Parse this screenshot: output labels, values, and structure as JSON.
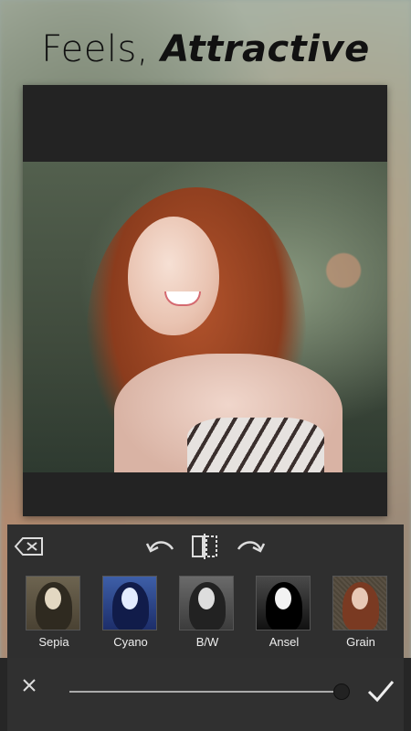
{
  "headline": {
    "light": "Feels, ",
    "bold": "Attractive"
  },
  "toolbar": {
    "erase_icon": "backspace-icon",
    "undo_icon": "undo-icon",
    "compare_icon": "compare-icon",
    "redo_icon": "redo-icon"
  },
  "filters": [
    {
      "label": "Sepia"
    },
    {
      "label": "Cyano"
    },
    {
      "label": "B/W"
    },
    {
      "label": "Ansel"
    },
    {
      "label": "Grain"
    }
  ],
  "bottom": {
    "close_icon": "close-icon",
    "confirm_icon": "check-icon",
    "intensity": 1.0
  },
  "colors": {
    "tray": "#2f2f2f",
    "frame": "#232323",
    "text": "#eeeeee"
  }
}
